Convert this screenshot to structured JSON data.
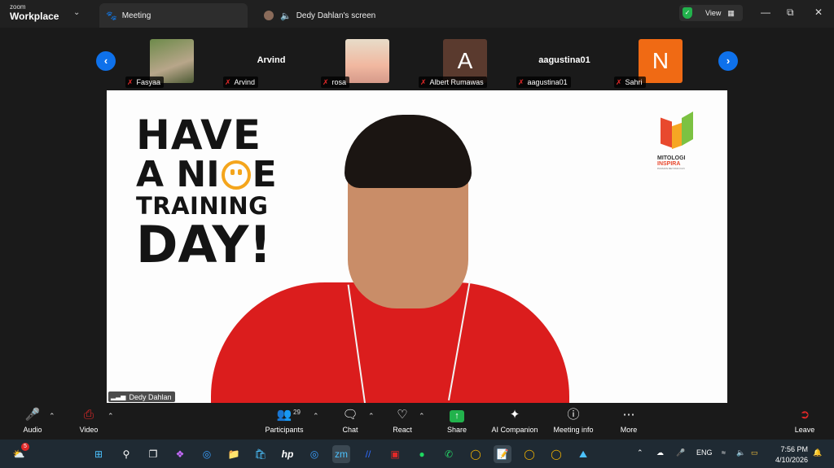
{
  "app": {
    "brand_top": "zoom",
    "brand_name": "Workplace"
  },
  "tabs": [
    {
      "label": "Meeting"
    },
    {
      "label": "Dedy Dahlan's screen"
    }
  ],
  "header": {
    "view_label": "View"
  },
  "participants": [
    {
      "name": "Fasyaa",
      "display": "photo"
    },
    {
      "name": "Arvind",
      "display": "name",
      "center_text": "Arvind"
    },
    {
      "name": "rosa",
      "display": "photo"
    },
    {
      "name": "Albert Rumawas",
      "display": "letter",
      "letter": "A",
      "color": "#5a3a2e"
    },
    {
      "name": "aagustina01",
      "display": "name",
      "center_text": "aagustina01"
    },
    {
      "name": "Sahri",
      "display": "letter",
      "letter": "N",
      "color": "#f06a14"
    }
  ],
  "share": {
    "headline": {
      "line1": "HAVE",
      "line2_a": "A NI",
      "line2_b": "E",
      "line3": "TRAINING",
      "line4": "DAY!"
    },
    "logo": {
      "line1": "MITOLOGI",
      "line2": "INSPIRA",
      "line3": "PASSION BEYOND FUN"
    },
    "speaker": "Dedy Dahlan"
  },
  "controls": {
    "audio": "Audio",
    "video": "Video",
    "participants": "Participants",
    "participants_count": "29",
    "chat": "Chat",
    "react": "React",
    "share": "Share",
    "ai_companion": "AI Companion",
    "meeting_info": "Meeting info",
    "more": "More",
    "leave": "Leave"
  },
  "taskbar": {
    "weather_badge": "5",
    "lang": "ENG",
    "time": "7:56 PM",
    "date": "4/10/2026"
  },
  "colors": {
    "accent_blue": "#0e71eb",
    "share_green": "#22b24c",
    "leave_red": "#e02828"
  }
}
